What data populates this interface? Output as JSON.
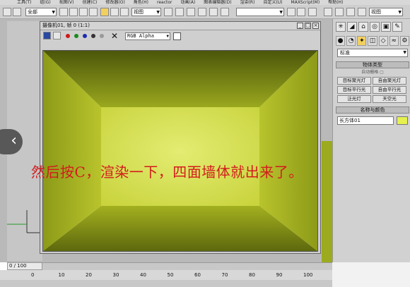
{
  "menu": [
    "工具(T)",
    "组(G)",
    "视图(V)",
    "创建(C)",
    "修改器(O)",
    "角色(H)",
    "reactor",
    "动画(A)",
    "图表编辑器(D)",
    "渲染(R)",
    "自定义(U)",
    "MAXScript(M)",
    "帮助(H)"
  ],
  "toolbar": {
    "selection_filter": "全部",
    "coord_combo": "视图",
    "named_sel": "",
    "right_combo": "视图"
  },
  "render_window": {
    "title": "摄像机01, 帧 0 (1:1)",
    "channel": "RGB Alpha"
  },
  "command_panel": {
    "combo": "标准",
    "section_object_type": "物体类型",
    "auto_grid": "自动栅格 ▢",
    "buttons": [
      "目标聚光灯",
      "自由聚光灯",
      "目标平行光",
      "自由平行光",
      "泛光灯",
      "天空光"
    ],
    "section_name_color": "名称与颜色",
    "object_name": "长方体01"
  },
  "annotation": "然后按C，渲染一下，四面墙体就出来了。",
  "timeline": {
    "frame_counter": "0 / 100",
    "ticks": [
      "0",
      "10",
      "20",
      "30",
      "40",
      "50",
      "60",
      "70",
      "80",
      "90",
      "100"
    ]
  },
  "nav": {
    "prev_arrow": "‹"
  },
  "colors": {
    "wall_light": "#dfe86a",
    "wall_dark": "#7a8612",
    "accent_red": "#d21c1c"
  }
}
